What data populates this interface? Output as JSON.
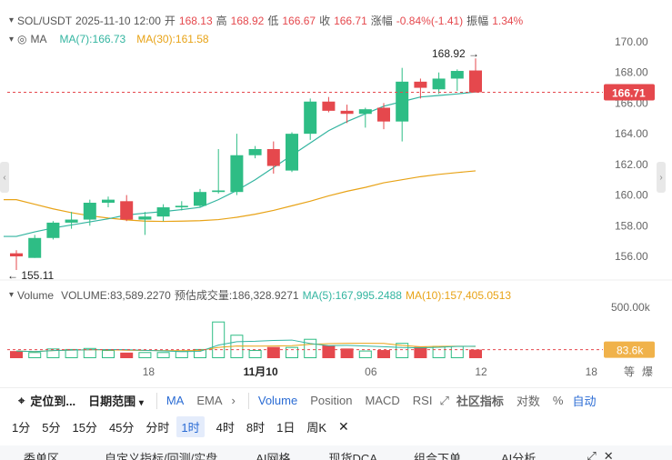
{
  "header": {
    "symbol": "SOL/USDT",
    "datetime": "2025-11-10 12:00",
    "open_label": "开",
    "open": "168.13",
    "high_label": "高",
    "high": "168.92",
    "low_label": "低",
    "low": "166.67",
    "close_label": "收",
    "close": "166.71",
    "change_label": "涨幅",
    "change": "-0.84%(-1.41)",
    "amplitude_label": "振幅",
    "amplitude": "1.34%"
  },
  "ma_legend": {
    "label": "MA",
    "ma7": "MA(7):166.73",
    "ma30": "MA(30):161.58"
  },
  "volume_legend": {
    "label": "Volume",
    "volume": "VOLUME:83,589.2270",
    "estimated": "预估成交量:186,328.9271",
    "ma5": "MA(5):167,995.2488",
    "ma10": "MA(10):157,405.0513"
  },
  "price_axis": {
    "ticks": [
      "170.00",
      "168.00",
      "166.00",
      "164.00",
      "162.00",
      "160.00",
      "158.00",
      "156.00"
    ],
    "current_price": "166.71",
    "high_marker": "168.92",
    "low_marker": "155.11"
  },
  "volume_axis": {
    "tick": "500.00k",
    "current_volume": "83.6k"
  },
  "time_axis": {
    "ticks": [
      "18",
      "11月10",
      "06",
      "12",
      "18"
    ],
    "right_labels": [
      "等",
      "爆"
    ]
  },
  "toolbar": {
    "locate": "定位到...",
    "date_range": "日期范围",
    "indicators_main": [
      "MA",
      "EMA"
    ],
    "indicators_sub": [
      "Volume",
      "Position",
      "MACD",
      "RSI"
    ],
    "community": "社区指标",
    "log": "对数",
    "percent": "%",
    "auto": "自动"
  },
  "intervals": [
    "1分",
    "5分",
    "15分",
    "45分",
    "分时",
    "1时",
    "4时",
    "8时",
    "1日",
    "周K"
  ],
  "active_interval": "1时",
  "bottom_tabs": [
    "委单区",
    "自定义指标/回测/实盘",
    "AI网格",
    "现货DCA",
    "组合下单",
    "AI分析"
  ],
  "colors": {
    "up": "#2ebd85",
    "down": "#e5484d",
    "ma7": "#33b5a0",
    "ma30": "#e8a317",
    "accent": "#2b6cd4"
  },
  "chart_data": {
    "type": "candlestick",
    "symbol": "SOL/USDT",
    "candles": [
      {
        "o": 156.2,
        "h": 156.4,
        "l": 155.11,
        "c": 156.0
      },
      {
        "o": 155.9,
        "h": 157.4,
        "l": 155.9,
        "c": 157.2
      },
      {
        "o": 157.2,
        "h": 158.3,
        "l": 157.1,
        "c": 158.2
      },
      {
        "o": 158.2,
        "h": 158.9,
        "l": 157.8,
        "c": 158.4
      },
      {
        "o": 158.4,
        "h": 159.7,
        "l": 158.0,
        "c": 159.5
      },
      {
        "o": 159.5,
        "h": 159.9,
        "l": 159.2,
        "c": 159.7
      },
      {
        "o": 159.6,
        "h": 160.0,
        "l": 158.3,
        "c": 158.4
      },
      {
        "o": 158.4,
        "h": 158.9,
        "l": 157.4,
        "c": 158.6
      },
      {
        "o": 158.6,
        "h": 159.4,
        "l": 158.3,
        "c": 159.2
      },
      {
        "o": 159.2,
        "h": 159.6,
        "l": 159.0,
        "c": 159.3
      },
      {
        "o": 159.3,
        "h": 160.4,
        "l": 159.2,
        "c": 160.2
      },
      {
        "o": 160.2,
        "h": 163.0,
        "l": 160.1,
        "c": 160.3
      },
      {
        "o": 160.2,
        "h": 164.0,
        "l": 160.0,
        "c": 162.6
      },
      {
        "o": 162.6,
        "h": 163.2,
        "l": 162.4,
        "c": 163.0
      },
      {
        "o": 163.0,
        "h": 163.5,
        "l": 161.4,
        "c": 161.9
      },
      {
        "o": 161.6,
        "h": 164.1,
        "l": 161.5,
        "c": 164.0
      },
      {
        "o": 164.0,
        "h": 166.3,
        "l": 163.6,
        "c": 166.1
      },
      {
        "o": 166.1,
        "h": 166.4,
        "l": 165.4,
        "c": 165.5
      },
      {
        "o": 165.5,
        "h": 165.9,
        "l": 164.7,
        "c": 165.3
      },
      {
        "o": 165.3,
        "h": 165.7,
        "l": 164.4,
        "c": 165.6
      },
      {
        "o": 165.7,
        "h": 166.0,
        "l": 164.3,
        "c": 164.8
      },
      {
        "o": 164.8,
        "h": 168.3,
        "l": 163.5,
        "c": 167.4
      },
      {
        "o": 167.4,
        "h": 167.6,
        "l": 166.3,
        "c": 167.0
      },
      {
        "o": 166.9,
        "h": 168.0,
        "l": 166.6,
        "c": 167.6
      },
      {
        "o": 167.6,
        "h": 168.2,
        "l": 166.8,
        "c": 168.1
      },
      {
        "o": 168.13,
        "h": 168.92,
        "l": 166.67,
        "c": 166.71
      }
    ],
    "volumes": [
      70,
      60,
      95,
      90,
      100,
      80,
      55,
      60,
      60,
      70,
      90,
      360,
      230,
      80,
      110,
      110,
      190,
      125,
      95,
      75,
      80,
      150,
      110,
      120,
      120,
      84
    ],
    "ma7": [
      157.3,
      157.6,
      157.85,
      158.05,
      158.25,
      158.45,
      158.7,
      158.82,
      158.92,
      159.05,
      159.2,
      159.7,
      160.3,
      161.0,
      161.8,
      162.6,
      163.4,
      164.2,
      164.8,
      165.3,
      165.8,
      166.1,
      166.4,
      166.5,
      166.6,
      166.73
    ],
    "ma30": [
      159.7,
      159.4,
      159.1,
      158.85,
      158.65,
      158.5,
      158.38,
      158.3,
      158.28,
      158.3,
      158.33,
      158.4,
      158.55,
      158.75,
      159.0,
      159.3,
      159.6,
      159.95,
      160.25,
      160.5,
      160.8,
      161.0,
      161.2,
      161.35,
      161.47,
      161.58
    ],
    "ylim": [
      155,
      170.5
    ],
    "grid": false,
    "current_price": 166.71
  }
}
